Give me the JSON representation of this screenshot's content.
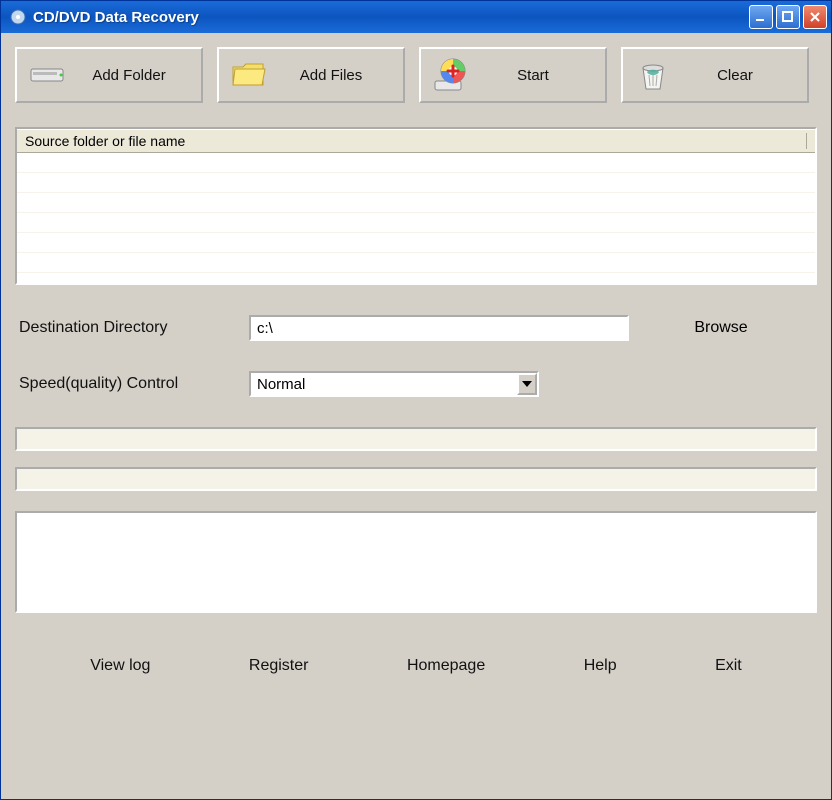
{
  "title": "CD/DVD Data Recovery",
  "toolbar": {
    "add_folder": "Add Folder",
    "add_files": "Add Files",
    "start": "Start",
    "clear": "Clear"
  },
  "list": {
    "header": "Source folder or file name"
  },
  "dest": {
    "label": "Destination Directory",
    "value": "c:\\",
    "browse": "Browse"
  },
  "speed": {
    "label": "Speed(quality) Control",
    "selected": "Normal"
  },
  "links": {
    "viewlog": "View log",
    "register": "Register",
    "homepage": "Homepage",
    "help": "Help",
    "exit": "Exit"
  }
}
